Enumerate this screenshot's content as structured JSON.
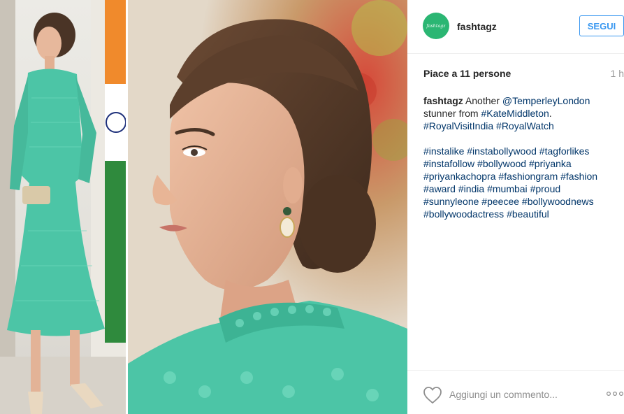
{
  "post": {
    "image_description_alt": ""
  },
  "header": {
    "username": "fashtagz",
    "avatar_text": "fashtagz",
    "follow_label": "SEGUI"
  },
  "stats": {
    "likes": "Piace a 11 persone",
    "time": "1 h"
  },
  "caption": {
    "user": "fashtagz",
    "word_another": "Another",
    "mention": "@TemperleyLondon",
    "word_stunner": "stunner from",
    "tag_kate": "#KateMiddleton",
    "period": ".",
    "tag_royalvisit": "#RoyalVisitIndia",
    "tag_royalwatch": "#RoyalWatch",
    "hashtags": [
      "#instalike",
      "#instabollywood",
      "#tagforlikes",
      "#instafollow",
      "#bollywood",
      "#priyanka",
      "#priyankachopra",
      "#fashiongram",
      "#fashion",
      "#award",
      "#india",
      "#mumbai",
      "#proud",
      "#sunnyleone",
      "#peecee",
      "#bollywoodnews",
      "#bollywoodactress",
      "#beautiful"
    ]
  },
  "comment": {
    "placeholder": "Aggiungi un commento..."
  },
  "icons": {
    "heart": "heart-outline-icon",
    "more": "more-dots-icon"
  },
  "colors": {
    "accent": "#3897f0",
    "link": "#003569",
    "avatar_bg": "#2bb673",
    "dress": "#4cc5a6"
  }
}
